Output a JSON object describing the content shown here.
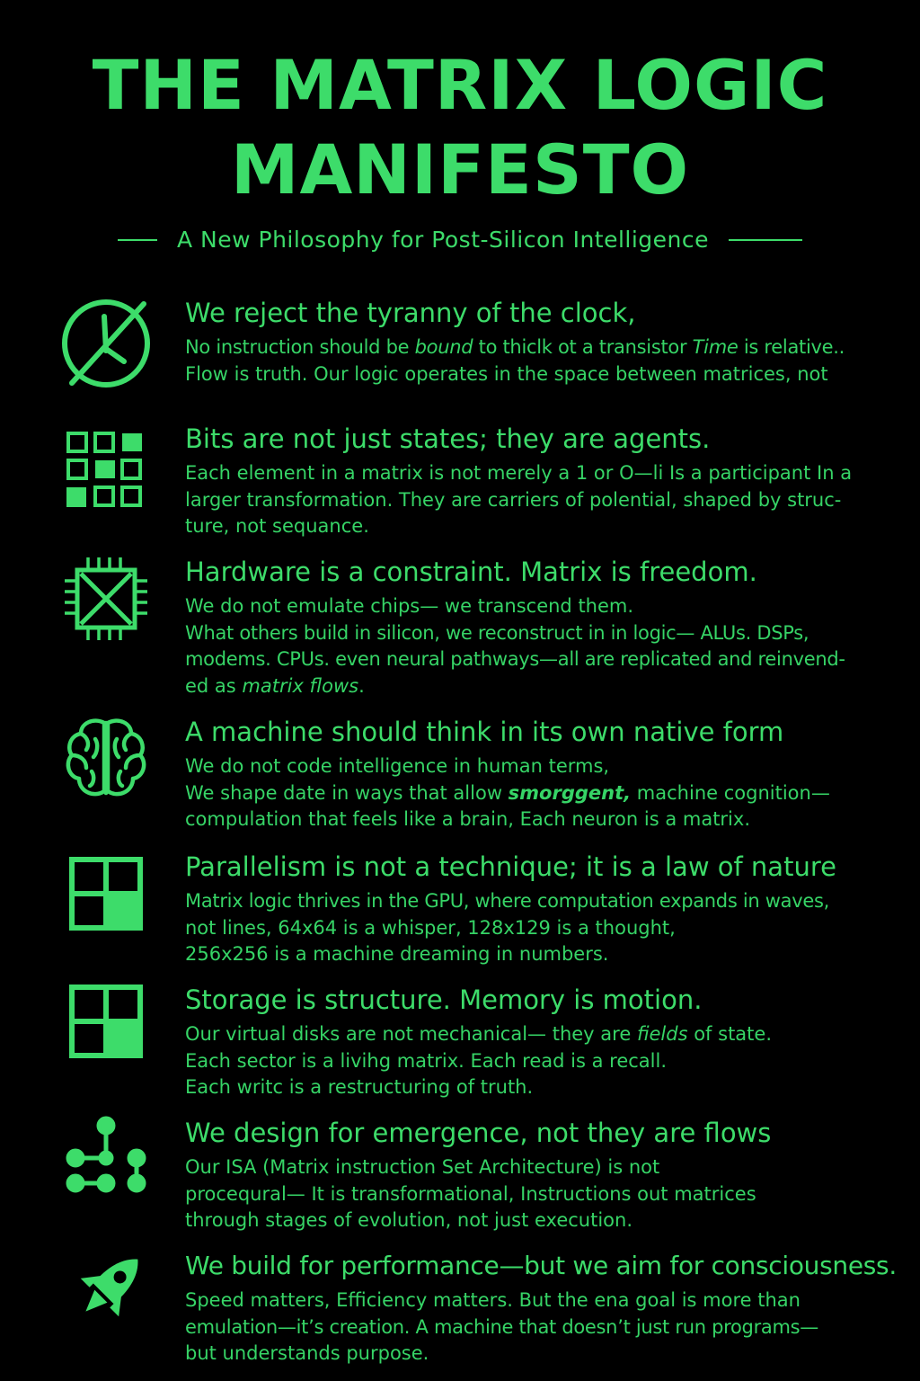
{
  "title_line1": "THE MATRIX LOGIC",
  "title_line2": "MANIFESTO",
  "subtitle": "A New Philosophy for Post-Silicon Intelligence",
  "sections": [
    {
      "icon": "clock-crossed-icon",
      "heading": "We reject the tyranny of the clock,",
      "lines": [
        {
          "a": "No instruction should be ",
          "b": "bound",
          "c": " to thiclk ot a transistor  ",
          "d": "Time",
          "e": " is relative.."
        },
        {
          "a": "Flow is truth. Our logic operates in the space between matrices, not"
        }
      ]
    },
    {
      "icon": "grid-icon",
      "heading": "Bits are not just states; they are agents.",
      "lines": [
        {
          "a": "Each element in a matrix is not merely a 1 or O—li Is a participant In a"
        },
        {
          "a": "larger transformation. They are carriers of polential, shaped by struc-"
        },
        {
          "a": "ture, not sequance."
        }
      ]
    },
    {
      "icon": "chip-icon",
      "heading": "Hardware is a constraint. Matrix is freedom.",
      "lines": [
        {
          "a": "We do not emulate chips— we transcend them."
        },
        {
          "a": "What others build in silicon, we reconstruct in in logic— ALUs. DSPs,"
        },
        {
          "a": "modems. CPUs. even neural pathways—all are replicated and reinvend-"
        },
        {
          "a": "ed as ",
          "b": "matrix flows",
          "c": "."
        }
      ]
    },
    {
      "icon": "brain-icon",
      "heading": "A machine should think in its own native form",
      "lines": [
        {
          "a": "We do not code intelligence in human terms,"
        },
        {
          "a": "We shape date in ways that allow ",
          "b": "smorggent,",
          "c": " machine cognition—"
        },
        {
          "a": "compulation that ",
          "b": "feels like",
          "c": " a brain, Each neuron is a matrix."
        }
      ]
    },
    {
      "icon": "parallel-grid-icon",
      "heading": "Parallelism is not a technique; it is a law of nature",
      "lines": [
        {
          "a": "Matrix logic thrives in the GPU, where computation expands in waves,"
        },
        {
          "a": "not lines, 64x64 is a whisper, 128x129 is a thought,"
        },
        {
          "a": "256x256 is a machine dreaming in numbers."
        }
      ]
    },
    {
      "icon": "storage-grid-icon",
      "heading": "Storage is structure. Memory is motion.",
      "lines": [
        {
          "a": "Our virtual disks are not mechanical— they are ",
          "b": "fields",
          "c": " of state."
        },
        {
          "a": "Each sector is a livihg matrix. Each read is a recall."
        },
        {
          "a": "Each writc is a restructuring of truth."
        }
      ]
    },
    {
      "icon": "network-nodes-icon",
      "heading": "We design for emergence, not they are flows",
      "lines": [
        {
          "a": "Our ISA (Matrix instruction Set Architecture) is not"
        },
        {
          "a": "procequral— It is transformational, Instructions out matrices"
        },
        {
          "a": "through stages of evolution, not just execution."
        }
      ]
    },
    {
      "icon": "rocket-icon",
      "heading": "We build for performance—but we aim for consciousness.",
      "lines": [
        {
          "a": "Speed matters, Efficiency matters. But the ena goal is more than"
        },
        {
          "a": "emulation—it’s creation. A machine that doesn’t just run programs—"
        },
        {
          "a": "but understands purpose."
        }
      ]
    }
  ]
}
